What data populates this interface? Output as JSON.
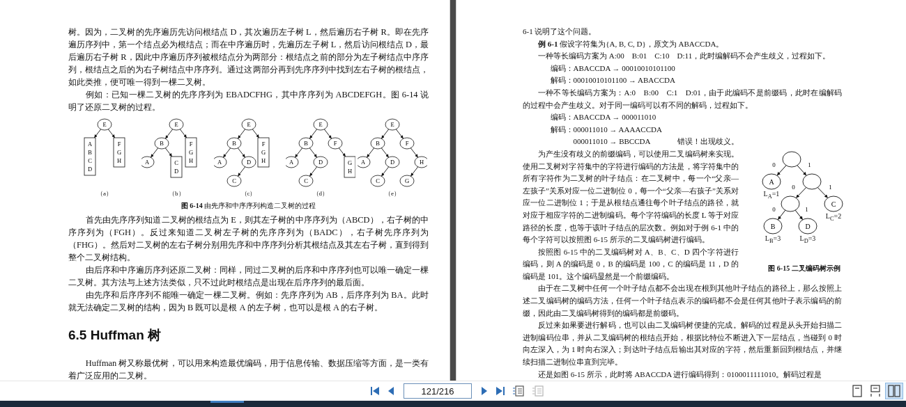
{
  "left_page": {
    "paragraphs_top": [
      {
        "indent": false,
        "text": "树。因为，二叉树的先序遍历先访问根结点 D，其次遍历左子树 L，然后遍历右子树 R。即在先序遍历序列中，第一个结点必为根结点；而在中序遍历时，先遍历左子树 L，然后访问根结点 D，最后遍历右子树 R，因此中序遍历序列被根结点分为两部分：根结点之前的部分为左子树结点中序序列，根结点之后的为右子树结点中序序列。通过这两部分再到先序序列中找到左右子树的根结点，如此类推，便可唯一得到一棵二叉树。"
      },
      {
        "indent": true,
        "text": "例如：已知一棵二叉树的先序序列为 EBADCFHG，其中序序列为 ABCDEFGH。图 6-14 说明了还原二叉树的过程。"
      }
    ],
    "figure": {
      "trees": [
        {
          "caption": "（a）",
          "root": {
            "kind": "circle",
            "label": "E",
            "left": {
              "kind": "box",
              "lines": [
                "A",
                "B",
                "C",
                "D"
              ]
            },
            "right": {
              "kind": "box",
              "lines": [
                "F",
                "G",
                "H"
              ]
            }
          }
        },
        {
          "caption": "（b）",
          "root": {
            "kind": "circle",
            "label": "E",
            "left": {
              "kind": "circle",
              "label": "B",
              "left": {
                "kind": "circle",
                "label": "A"
              },
              "right": {
                "kind": "box",
                "lines": [
                  "C",
                  "D"
                ]
              }
            },
            "right": {
              "kind": "box",
              "lines": [
                "F",
                "G",
                "H"
              ]
            }
          }
        },
        {
          "caption": "（c）",
          "root": {
            "kind": "circle",
            "label": "E",
            "left": {
              "kind": "circle",
              "label": "B",
              "left": {
                "kind": "circle",
                "label": "A"
              },
              "right": {
                "kind": "circle",
                "label": "D",
                "left": {
                  "kind": "circle",
                  "label": "C"
                }
              }
            },
            "right": {
              "kind": "box",
              "lines": [
                "F",
                "G",
                "H"
              ]
            }
          }
        },
        {
          "caption": "（d）",
          "root": {
            "kind": "circle",
            "label": "E",
            "left": {
              "kind": "circle",
              "label": "B",
              "left": {
                "kind": "circle",
                "label": "A"
              },
              "right": {
                "kind": "circle",
                "label": "D",
                "left": {
                  "kind": "circle",
                  "label": "C"
                }
              }
            },
            "right": {
              "kind": "circle",
              "label": "F",
              "right": {
                "kind": "box",
                "lines": [
                  "G",
                  "H"
                ]
              }
            }
          }
        },
        {
          "caption": "（e）",
          "root": {
            "kind": "circle",
            "label": "E",
            "left": {
              "kind": "circle",
              "label": "B",
              "left": {
                "kind": "circle",
                "label": "A"
              },
              "right": {
                "kind": "circle",
                "label": "D",
                "left": {
                  "kind": "circle",
                  "label": "C"
                }
              }
            },
            "right": {
              "kind": "circle",
              "label": "F",
              "right": {
                "kind": "circle",
                "label": "H",
                "left": {
                  "kind": "circle",
                  "label": "G"
                }
              }
            }
          }
        }
      ],
      "caption": "**图 6-14** 由先序和中序序列构造二叉树的过程"
    },
    "paragraphs_mid": [
      {
        "indent": true,
        "text": "首先由先序序列知道二叉树的根结点为 E，则其左子树的中序序列为（ABCD），右子树的中序序列为（FGH）。反过来知道二叉树左子树的先序序列为（BADC），右子树先序序列为（FHG）。然后对二叉树的左右子树分别用先序和中序序列分析其根结点及其左右子树，直到得到整个二叉树结构。"
      },
      {
        "indent": true,
        "text": "由后序和中序遍历序列还原二叉树：同样，同过二叉树的后序和中序序列也可以唯一确定一棵二叉树。其方法与上述方法类似，只不过此时根结点是出现在后序序列的最后面。"
      },
      {
        "indent": true,
        "text": "由先序和后序序列不能唯一确定一棵二叉树。例如：先序序列为 AB，后序序列为 BA。此时就无法确定二叉树的结构，因为 B 既可以是根 A 的左子树，也可以是根 A 的右子树。"
      }
    ],
    "heading": "6.5 Huffman 树",
    "paragraphs_bottom": [
      {
        "indent": true,
        "text": "Huffman 树又称最优树，可以用来构造最优编码，用于信息传输、数据压缩等方面，是一类有着广泛应用的二叉树。"
      }
    ]
  },
  "right_page": {
    "blocks": [
      {
        "kind": "paragraph",
        "indent": false,
        "text": "6-1 说明了这个问题。"
      },
      {
        "kind": "paragraph",
        "indent": true,
        "text": "**例 6-1** 假设字符集为{A, B, C, D}，原文为 ABACCDA。"
      },
      {
        "kind": "paragraph",
        "indent": true,
        "text": "一种等长编码方案为 A:00　B:01　C:10　D:11，此时编解码不会产生歧义，过程如下。"
      },
      {
        "kind": "code",
        "label": "编码：",
        "lines": [
          {
            "text": "ABACCDA → 00010010101100"
          }
        ]
      },
      {
        "kind": "code",
        "label": "解码：",
        "lines": [
          {
            "text": "00010010101100 → ABACCDA"
          }
        ]
      },
      {
        "kind": "paragraph",
        "indent": true,
        "text": "一种不等长编码方案为：A:0　B:00　C:1　D:01，由于此编码不是前缀码，此时在编解码的过程中会产生歧义。对于同一编码可以有不同的解码，过程如下。"
      },
      {
        "kind": "code",
        "label": "编码：",
        "lines": [
          {
            "text": "ABACCDA → 000011010"
          }
        ]
      },
      {
        "kind": "code",
        "label": "解码：",
        "lines": [
          {
            "text": "000011010 → AAAACCDA"
          },
          {
            "text": "000011010 → BBCCDA",
            "note": "错误！出现歧义。"
          }
        ]
      },
      {
        "kind": "figure_row",
        "paragraphs": [
          {
            "indent": true,
            "text": "为产生没有歧义的前缀编码，可以使用二叉编码树来实现。使用二叉树对字符集中的字符进行编码的方法是，将字符集中的所有字符作为二叉树的叶子结点：在二叉树中，每一个“父亲—左孩子”关系对应一位二进制位 0，每一个“父亲—右孩子”关系对应一位二进制位 1；于是从根结点通往每个叶子结点的路径，就对应于相应字符的二进制编码。每个字符编码的长度 L 等于对应路径的长度，也等于该叶子结点的层次数。例如对于例 6-1 中的每个字符可以按照图 6-15 所示的二叉编码树进行编码。"
          },
          {
            "indent": true,
            "text": "按照图 6-15 中的二叉编码树对 A、B、C、D 四个字符进行编码，则 A 的编码是 0，B 的编码是 100，C 的编码是 11，D 的编码是 101。这个编码显然是一个前缀编码。"
          }
        ],
        "figure": {
          "caption": "图 6-15  二叉编码树示例",
          "root": {
            "kind": "circle",
            "left": {
              "edge": "0",
              "kind": "circle",
              "label": "A",
              "caption": "L$_{A}$=1"
            },
            "right": {
              "edge": "1",
              "kind": "circle",
              "left": {
                "edge": "0",
                "kind": "circle",
                "left": {
                  "edge": "0",
                  "kind": "circle",
                  "label": "B",
                  "caption": "L$_{B}$=3"
                },
                "right": {
                  "edge": "1",
                  "kind": "circle",
                  "label": "D",
                  "caption": "L$_{D}$=3"
                }
              },
              "right": {
                "edge": "1",
                "kind": "circle",
                "label": "C",
                "caption": "L$_{C}$=2"
              }
            }
          }
        }
      },
      {
        "kind": "paragraph",
        "indent": true,
        "text": "由于在二叉树中任何一个叶子结点都不会出现在根到其他叶子结点的路径上，那么按照上述二叉编码树的编码方法，任何一个叶子结点表示的编码都不会是任何其他叶子表示编码的前缀，因此由二叉编码树得到的编码都是前缀码。"
      },
      {
        "kind": "paragraph",
        "indent": true,
        "text": "反过来如果要进行解码，也可以由二叉编码树便捷的完成。解码的过程是从头开始扫描二进制编码位串，并从二叉编码树的根结点开始，根据比特位不断进入下一层结点，当碰到 0 时向左深入，为 1 时向右深入；到达叶子结点后输出其对应的字符，然后重新回到根结点，并继续扫描二进制位串直到完毕。"
      },
      {
        "kind": "paragraph",
        "indent": true,
        "text": "还是如图 6-15 所示，此时将 ABACCDA 进行编码得到：0100011111010。解码过程是"
      }
    ]
  },
  "toolbar": {
    "page_field": {
      "value": "121/216"
    },
    "tools": [
      {
        "kind": "list",
        "disabled": false
      },
      {
        "kind": "list",
        "disabled": true
      }
    ],
    "view_modes": [
      {
        "kind": "single",
        "selected": false
      },
      {
        "kind": "continuous",
        "selected": false
      },
      {
        "kind": "double",
        "selected": true
      }
    ]
  }
}
